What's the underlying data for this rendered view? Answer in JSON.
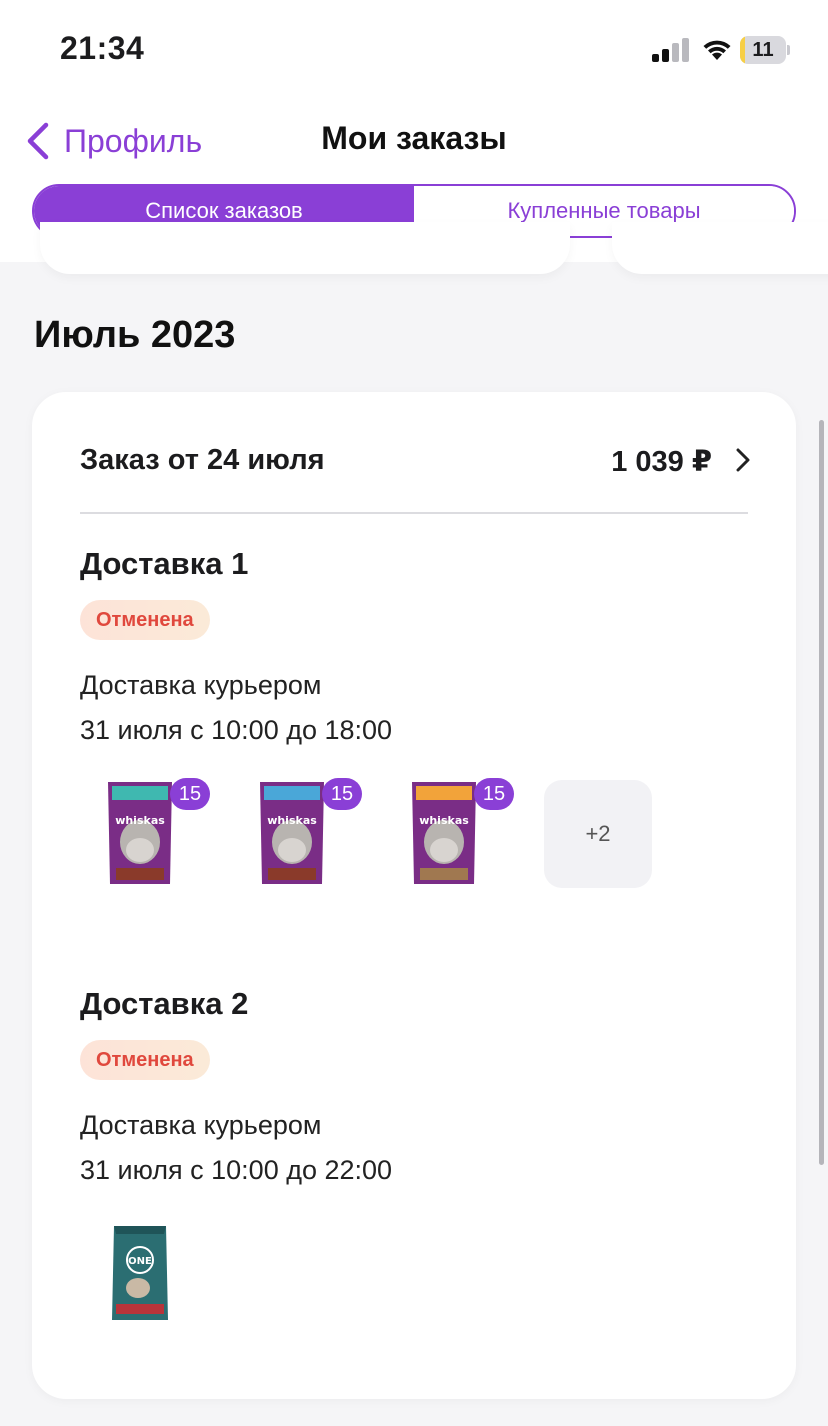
{
  "status_bar": {
    "time": "21:34",
    "battery_level": "11",
    "battery_fraction": 0.11,
    "icons": [
      "signal-icon",
      "wifi-icon",
      "battery-icon"
    ]
  },
  "nav": {
    "back_label": "Профиль",
    "back_icon": "chevron-left-icon",
    "title": "Мои заказы"
  },
  "tabs": [
    {
      "label": "Список заказов",
      "active": true
    },
    {
      "label": "Купленные товары",
      "active": false
    }
  ],
  "section": {
    "title": "Июль 2023"
  },
  "order": {
    "title": "Заказ от 24 июля",
    "total": "1 039 ₽",
    "chevron_icon": "chevron-right-icon",
    "deliveries": [
      {
        "title": "Доставка 1",
        "status": "Отменена",
        "method": "Доставка курьером",
        "time": "31 июля с 10:00 до 18:00",
        "products": [
          {
            "brand": "whiskas",
            "quantity": "15",
            "accent": "#3fb8b0"
          },
          {
            "brand": "whiskas",
            "quantity": "15",
            "accent": "#4aa7d8"
          },
          {
            "brand": "whiskas",
            "quantity": "15",
            "accent": "#f2a33a"
          }
        ],
        "more_label": "+2"
      },
      {
        "title": "Доставка 2",
        "status": "Отменена",
        "method": "Доставка курьером",
        "time": "31 июля с 10:00 до 22:00",
        "products": [
          {
            "brand": "ONE",
            "quantity": "",
            "accent": "#2b6e72"
          }
        ]
      }
    ]
  },
  "colors": {
    "accent": "#8a3fd6",
    "status_cancelled_text": "#e0483d",
    "status_cancelled_bg": "#fde3d8",
    "background": "#f5f5f7"
  }
}
